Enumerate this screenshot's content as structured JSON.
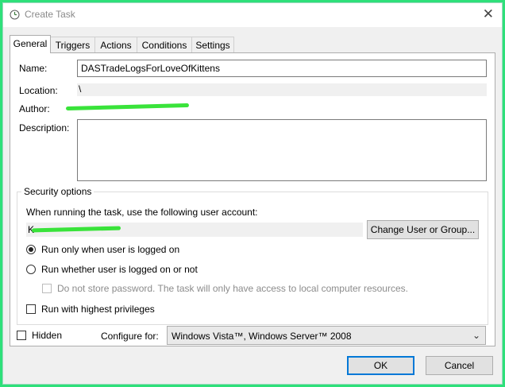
{
  "window": {
    "title": "Create Task",
    "icon": "clock-icon",
    "close_glyph": "✕"
  },
  "tabs": [
    "General",
    "Triggers",
    "Actions",
    "Conditions",
    "Settings"
  ],
  "general": {
    "name_label": "Name:",
    "name_value": "DASTradeLogsForLoveOfKittens",
    "location_label": "Location:",
    "location_value": "\\",
    "author_label": "Author:",
    "description_label": "Description:",
    "description_value": ""
  },
  "security": {
    "title": "Security options",
    "account_prompt": "When running the task, use the following user account:",
    "account_value": "K",
    "change_button": "Change User or Group...",
    "run_logged_on": "Run only when user is logged on",
    "run_whether": "Run whether user is logged on or not",
    "do_not_store": "Do not store password.  The task will only have access to local computer resources.",
    "highest_privileges": "Run with highest privileges"
  },
  "bottom": {
    "hidden_label": "Hidden",
    "configure_label": "Configure for:",
    "configure_value": "Windows Vista™, Windows Server™ 2008",
    "ok": "OK",
    "cancel": "Cancel"
  },
  "colors": {
    "accent": "#0078d7",
    "redaction": "#39e33a",
    "background": "#2ee07a"
  }
}
